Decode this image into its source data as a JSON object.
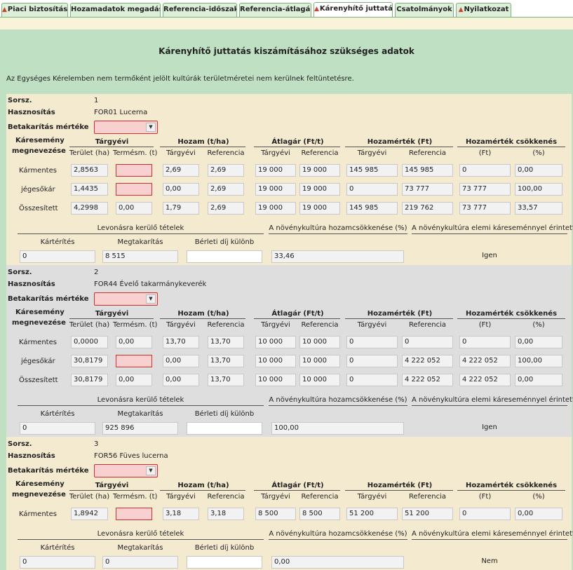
{
  "tabs": [
    {
      "label": "Piaci biztosítás",
      "warn": true,
      "active": false
    },
    {
      "label": "Hozamadatok megadása",
      "warn": false,
      "active": false
    },
    {
      "label": "Referencia-időszak",
      "warn": false,
      "active": false
    },
    {
      "label": "Referencia-átlagár",
      "warn": false,
      "active": false
    },
    {
      "label": "Kárenyhítő juttatás",
      "warn": true,
      "active": true
    },
    {
      "label": "Csatolmányok",
      "warn": false,
      "active": false
    },
    {
      "label": "Nyilatkozat",
      "warn": true,
      "active": false
    }
  ],
  "page": {
    "title": "Kárenyhítő juttatás kiszámításához szükséges adatok",
    "note": "Az Egységes Kérelemben nem termőként jelölt kultúrák területméretei nem kerülnek feltüntetésre."
  },
  "labels": {
    "sorsz": "Sorsz.",
    "hasznositas": "Hasznosítás",
    "betakaritas": "Betakarítás mértéke",
    "kare1": "Káresemény",
    "kare2": "megnevezése",
    "targyevi_group": "Tárgyévi",
    "hozam_group": "Hozam (t/ha)",
    "atlagar_group": "Átlagár (Ft/t)",
    "hozamertek_group": "Hozamérték (Ft)",
    "csokkenes_group": "Hozamérték csökkenés",
    "terulet": "Terület (ha)",
    "termesm": "Termésm. (t)",
    "targyevi": "Tárgyévi",
    "referencia": "Referencia",
    "ft": "(Ft)",
    "pct": "(%)",
    "levonas": "Levonásra kerülő tételek",
    "hozamcsokkenes": "A növénykultúra hozamcsökkenése (%)",
    "elemi": "A növénykultúra elemi káreseménnyel érintett",
    "karterites": "Kártérítés",
    "megtakaritas": "Megtakarítás",
    "berleti": "Bérleti díj különb"
  },
  "sections": [
    {
      "sorsz": "1",
      "hasznositas": "FOR01 Lucerna",
      "rows": [
        {
          "name": "Kármentes",
          "cells": [
            "2,8563",
            "",
            "2,69",
            "2,69",
            "19 000",
            "19 000",
            "145 985",
            "145 985",
            "0",
            "0,00"
          ]
        },
        {
          "name": "jégesőkár",
          "cells": [
            "1,4435",
            "",
            "0,00",
            "2,69",
            "19 000",
            "19 000",
            "0",
            "73 777",
            "73 777",
            "100,00"
          ]
        },
        {
          "name": "Összesített",
          "cells": [
            "4,2998",
            "0,00",
            "1,79",
            "2,69",
            "19 000",
            "19 000",
            "145 985",
            "219 762",
            "73 777",
            "33,57"
          ]
        }
      ],
      "karterites": "0",
      "megtakaritas": "8 515",
      "berleti": "",
      "hozamcsokkenes": "33,46",
      "elemi": "Igen"
    },
    {
      "sorsz": "2",
      "hasznositas": "FOR44 Évelő takarmánykeverék",
      "rows": [
        {
          "name": "Kármentes",
          "cells": [
            "0,0000",
            "0,00",
            "13,70",
            "13,70",
            "10 000",
            "10 000",
            "0",
            "0",
            "0",
            "0,00"
          ]
        },
        {
          "name": "jégesőkár",
          "cells": [
            "30,8179",
            "",
            "0,00",
            "13,70",
            "10 000",
            "10 000",
            "0",
            "4 222 052",
            "4 222 052",
            "100,00"
          ]
        },
        {
          "name": "Összesített",
          "cells": [
            "30,8179",
            "0,00",
            "0,00",
            "13,70",
            "10 000",
            "10 000",
            "0",
            "4 222 052",
            "4 222 052",
            "0,00"
          ]
        }
      ],
      "karterites": "0",
      "megtakaritas": "925 896",
      "berleti": "",
      "hozamcsokkenes": "100,00",
      "elemi": "Igen"
    },
    {
      "sorsz": "3",
      "hasznositas": "FOR56 Füves lucerna",
      "rows": [
        {
          "name": "Kármentes",
          "cells": [
            "1,8942",
            "",
            "3,18",
            "3,18",
            "8 500",
            "8 500",
            "51 200",
            "51 200",
            "0",
            "0,00"
          ]
        }
      ],
      "karterites": "0",
      "megtakaritas": "0",
      "berleti": "",
      "hozamcsokkenes": "0,00",
      "elemi": "Nem"
    }
  ]
}
